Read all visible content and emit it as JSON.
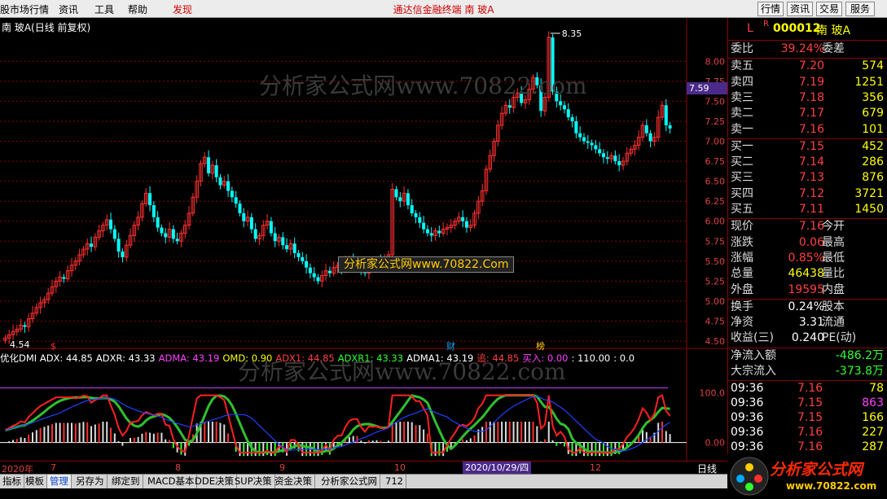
{
  "menu": {
    "items": [
      {
        "label": "股市场行情",
        "x": 0
      },
      {
        "label": "资讯",
        "x": 72
      },
      {
        "label": "工具",
        "x": 116
      },
      {
        "label": "帮助",
        "x": 157
      },
      {
        "label": "发现",
        "x": 212
      }
    ],
    "center_title": "通达信金融终端   南 玻A",
    "right_buttons": [
      "行情",
      "资讯",
      "交易",
      "服务"
    ]
  },
  "chart": {
    "title": "南 玻A(日线 前复权)",
    "price_tag": "7.59",
    "high_label": "8.35",
    "low_label": "4.54",
    "watermark_box": "分析家公式网www.70822.Com",
    "watermark_faint": "分析家公式网www.70822.com",
    "markers": [
      "$",
      "财",
      "榜"
    ],
    "indicator_line": [
      {
        "text": "优化DMI ADX: 44.85",
        "color": "#ffffff"
      },
      {
        "text": "ADXR: 43.33",
        "color": "#ffffff"
      },
      {
        "text": "ADMA: 43.19",
        "color": "#ff40ff"
      },
      {
        "text": "OMD: 0.90",
        "color": "#ffff00"
      },
      {
        "text": "ADX1: 44.85",
        "color": "#ff4040"
      },
      {
        "text": "ADXR1: 43.33",
        "color": "#30ff30"
      },
      {
        "text": "ADMA1: 43.19",
        "color": "#ffffff"
      },
      {
        "text": "追: 44.85",
        "color": "#ff4040"
      },
      {
        "text": "买入: 0.00",
        "color": "#ff40ff"
      },
      {
        "text": ": 110.00",
        "color": "#ffffff"
      },
      {
        "text": ": 0.0",
        "color": "#ffffff"
      }
    ],
    "indicator_axis": [
      "100.0",
      "0.00"
    ]
  },
  "chart_data": {
    "type": "candlestick",
    "y_ticks": [
      "8.00",
      "7.75",
      "7.50",
      "7.25",
      "7.00",
      "6.75",
      "6.50",
      "6.25",
      "6.00",
      "5.75",
      "5.50",
      "5.25",
      "5.00",
      "4.75",
      "4.50"
    ],
    "y_range": [
      4.45,
      8.4
    ],
    "close": [
      4.54,
      4.58,
      4.62,
      4.65,
      4.7,
      4.68,
      4.78,
      4.85,
      4.92,
      4.98,
      5.02,
      5.1,
      5.18,
      5.25,
      5.3,
      5.28,
      5.38,
      5.45,
      5.5,
      5.58,
      5.65,
      5.72,
      5.68,
      5.8,
      5.88,
      5.95,
      6.02,
      5.9,
      5.78,
      5.62,
      5.55,
      5.7,
      5.82,
      5.95,
      6.05,
      6.22,
      6.35,
      6.2,
      6.05,
      5.92,
      5.85,
      5.8,
      5.9,
      5.78,
      5.75,
      5.85,
      5.95,
      6.1,
      6.3,
      6.5,
      6.72,
      6.8,
      6.6,
      6.7,
      6.55,
      6.45,
      6.5,
      6.38,
      6.3,
      6.22,
      6.1,
      6.0,
      6.05,
      5.9,
      5.78,
      5.82,
      5.95,
      6.0,
      5.85,
      5.75,
      5.8,
      5.7,
      5.65,
      5.72,
      5.6,
      5.55,
      5.5,
      5.42,
      5.35,
      5.3,
      5.25,
      5.32,
      5.38,
      5.35,
      5.42,
      5.45,
      5.4,
      5.48,
      5.52,
      5.5,
      5.45,
      5.38,
      5.35,
      5.42,
      5.48,
      5.52,
      5.45,
      5.5,
      5.58,
      6.4,
      6.3,
      6.25,
      6.35,
      6.2,
      6.1,
      6.05,
      5.98,
      5.9,
      5.85,
      5.82,
      5.88,
      5.85,
      5.9,
      5.92,
      5.95,
      6.0,
      6.05,
      6.0,
      5.92,
      5.95,
      6.1,
      6.25,
      6.38,
      6.65,
      6.82,
      7.0,
      7.2,
      7.35,
      7.45,
      7.42,
      7.55,
      7.6,
      7.48,
      7.52,
      7.65,
      7.8,
      7.7,
      7.38,
      7.55,
      8.3,
      7.62,
      7.5,
      7.45,
      7.4,
      7.3,
      7.25,
      7.1,
      7.05,
      7.0,
      6.98,
      6.95,
      6.9,
      6.85,
      6.8,
      6.78,
      6.82,
      6.75,
      6.7,
      6.75,
      6.85,
      6.9,
      6.95,
      7.05,
      7.2,
      7.1,
      7.0,
      7.05,
      7.3,
      7.45,
      7.2,
      7.16
    ],
    "indicator_range": [
      -30,
      150
    ]
  },
  "timeaxis": {
    "labels": [
      {
        "text": "2020年",
        "x": 2
      },
      {
        "text": "7",
        "x": 62
      },
      {
        "text": "8",
        "x": 215
      },
      {
        "text": "9",
        "x": 343
      },
      {
        "text": "10",
        "x": 484
      },
      {
        "text": "12",
        "x": 724
      }
    ],
    "cursor_date": "2020/10/29/四",
    "period": "日线"
  },
  "tabs": [
    "指标",
    "模板",
    "管理",
    "另存为",
    "绑定到",
    "MACD基本",
    "DDE决策",
    "SUP决策",
    "资金决策",
    "分析家公式网",
    "712"
  ],
  "panel": {
    "code_prefix": "L",
    "r_mark": "R",
    "code": "000012",
    "name": "南 玻A",
    "weibi": {
      "label": "委比",
      "value": "39.24%",
      "label2": "委差"
    },
    "asks": [
      {
        "label": "卖五",
        "price": "7.20",
        "vol": "574"
      },
      {
        "label": "卖四",
        "price": "7.19",
        "vol": "1251"
      },
      {
        "label": "卖三",
        "price": "7.18",
        "vol": "356"
      },
      {
        "label": "卖二",
        "price": "7.17",
        "vol": "679"
      },
      {
        "label": "卖一",
        "price": "7.16",
        "vol": "101"
      }
    ],
    "bids": [
      {
        "label": "买一",
        "price": "7.15",
        "vol": "452"
      },
      {
        "label": "买二",
        "price": "7.14",
        "vol": "286"
      },
      {
        "label": "买三",
        "price": "7.13",
        "vol": "876"
      },
      {
        "label": "买四",
        "price": "7.12",
        "vol": "3721"
      },
      {
        "label": "买五",
        "price": "7.11",
        "vol": "1450"
      }
    ],
    "stats": [
      {
        "label": "现价",
        "value": "7.16",
        "label2": "今开",
        "color": "red"
      },
      {
        "label": "涨跌",
        "value": "0.06",
        "label2": "最高",
        "color": "red"
      },
      {
        "label": "涨幅",
        "value": "0.85%",
        "label2": "最低",
        "color": "red"
      },
      {
        "label": "总量",
        "value": "46438",
        "label2": "量比",
        "color": "yel"
      },
      {
        "label": "外盘",
        "value": "19595",
        "label2": "内盘",
        "color": "red"
      }
    ],
    "stats2": [
      {
        "label": "换手",
        "value": "0.24%",
        "label2": "股本",
        "color": "wht"
      },
      {
        "label": "净资",
        "value": "3.31",
        "label2": "流通",
        "color": "wht"
      },
      {
        "label": "收益(三)",
        "value": "0.240",
        "label2": "PE(动)",
        "color": "wht"
      }
    ],
    "flows": [
      {
        "label": "净流入额",
        "value": "-486.2万"
      },
      {
        "label": "大宗流入",
        "value": "-373.8万"
      }
    ],
    "ticks": [
      {
        "time": "09:36",
        "price": "7.16",
        "vol": "78",
        "vcolor": "yel"
      },
      {
        "time": "09:36",
        "price": "7.15",
        "vol": "863",
        "vcolor": "mag"
      },
      {
        "time": "09:36",
        "price": "7.15",
        "vol": "166",
        "vcolor": "yel"
      },
      {
        "time": "09:36",
        "price": "7.16",
        "vol": "227",
        "vcolor": "yel"
      },
      {
        "time": "09:36",
        "price": "7.16",
        "vol": "287",
        "vcolor": "yel"
      }
    ]
  },
  "logo": {
    "text": "分析家公式网",
    "url": "www.70822.com"
  },
  "colors": {
    "up": "#ff3030",
    "down": "#00ffff",
    "grid": "#8b0000",
    "accent_purple": "#4b2a8a"
  }
}
